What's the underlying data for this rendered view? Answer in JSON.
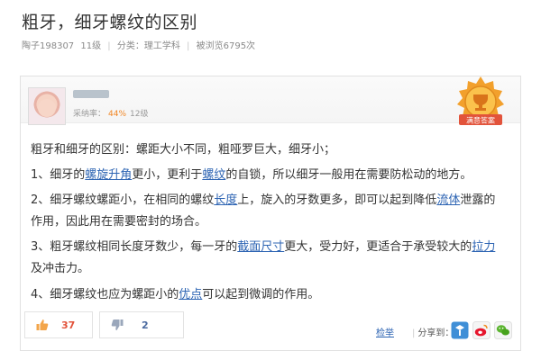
{
  "question": {
    "title": "粗牙，细牙螺纹的区别",
    "asker": "陶子198307",
    "asker_level": "11级",
    "category_label": "分类：",
    "category": "理工学科",
    "views": "被浏览6795次"
  },
  "answer": {
    "adopt_label": "采纳率：",
    "adopt_rate": "44%",
    "level": "12级",
    "badge_text": "满意答案",
    "lines": [
      {
        "parts": [
          {
            "t": "粗牙和细牙的区别：螺距大小不同，粗哑罗巨大，细牙小；"
          }
        ]
      },
      {
        "parts": [
          {
            "t": "1、细牙的"
          },
          {
            "t": "螺旋升角",
            "k": true
          },
          {
            "t": "更小，更利于"
          },
          {
            "t": "螺纹",
            "k": true
          },
          {
            "t": "的自锁，所以细牙一般用在需要防松动的地方。"
          }
        ]
      },
      {
        "parts": [
          {
            "t": "2、细牙螺纹螺距小，在相同的螺纹"
          },
          {
            "t": "长度",
            "k": true
          },
          {
            "t": "上，旋入的牙数更多，即可以起到降低"
          },
          {
            "t": "流体",
            "k": true
          },
          {
            "t": "泄露的"
          }
        ]
      },
      {
        "parts": [
          {
            "t": "作用，因此用在需要密封的场合。"
          }
        ]
      },
      {
        "parts": [
          {
            "t": "3、粗牙螺纹相同长度牙数少，每一牙的"
          },
          {
            "t": "截面尺寸",
            "k": true
          },
          {
            "t": "更大，受力好，更适合于承受较大的"
          },
          {
            "t": "拉力",
            "k": true
          }
        ]
      },
      {
        "parts": [
          {
            "t": "及冲击力。"
          }
        ]
      },
      {
        "parts": [
          {
            "t": "4、细牙螺纹也应为螺距小的"
          },
          {
            "t": "优点",
            "k": true
          },
          {
            "t": "可以起到微调的作用。"
          }
        ]
      }
    ]
  },
  "actions": {
    "upvotes": "37",
    "downvotes": "2",
    "report": "检举",
    "share": "分享到："
  },
  "icons": {
    "thumb_up": "thumb-up-icon",
    "thumb_down": "thumb-down-icon",
    "share_1": "share-t-icon",
    "share_2": "weibo-icon",
    "share_3": "wechat-icon",
    "medal": "medal-icon"
  },
  "colors": {
    "link": "#2d64b3",
    "rate": "#f18624",
    "upvote": "#e2533b"
  }
}
